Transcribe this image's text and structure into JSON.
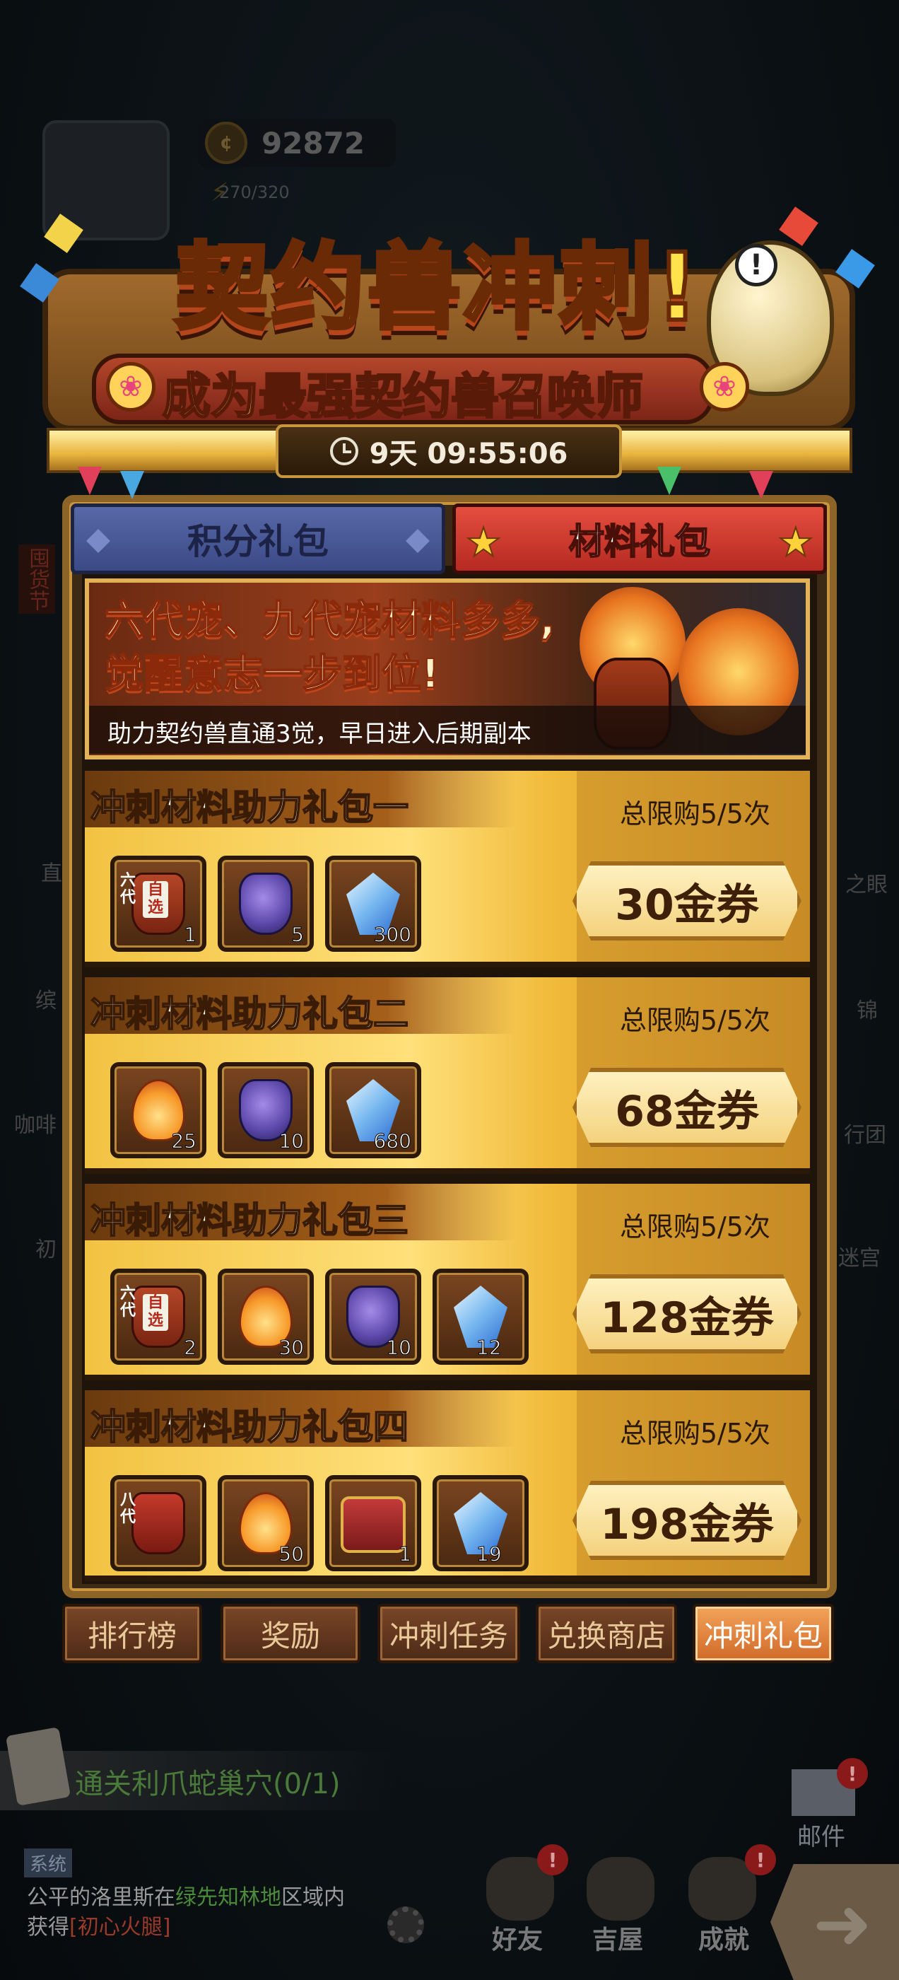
{
  "hud": {
    "currency_value": "92872",
    "energy": "270/320"
  },
  "header": {
    "title": "契约兽冲刺!",
    "subtitle": "成为最强契约兽召唤师",
    "timer": "9天 09:55:06"
  },
  "tabs": [
    {
      "label": "积分礼包",
      "active": false
    },
    {
      "label": "材料礼包",
      "active": true
    }
  ],
  "promo": {
    "line1": "六代宠、九代宠材料多多,",
    "line2": "觉醒意志一步到位!",
    "subtitle": "助力契约兽直通3觉，早日进入后期副本"
  },
  "packages": [
    {
      "title": "冲刺材料助力礼包一",
      "limit": "总限购5/5次",
      "price": "30金券",
      "items": [
        {
          "icon": "six-gen-select-jar-icon",
          "tier": "六代",
          "tag": "自选",
          "qty": "1"
        },
        {
          "icon": "purple-vase-icon",
          "qty": "5"
        },
        {
          "icon": "blue-crystal-icon",
          "qty": "300"
        }
      ]
    },
    {
      "title": "冲刺材料助力礼包二",
      "limit": "总限购5/5次",
      "price": "68金券",
      "items": [
        {
          "icon": "flame-spirit-icon",
          "qty": "25"
        },
        {
          "icon": "purple-vase-icon",
          "qty": "10"
        },
        {
          "icon": "blue-crystal-icon",
          "qty": "680"
        }
      ]
    },
    {
      "title": "冲刺材料助力礼包三",
      "limit": "总限购5/5次",
      "price": "128金券",
      "items": [
        {
          "icon": "six-gen-select-jar-icon",
          "tier": "六代",
          "tag": "自选",
          "qty": "2"
        },
        {
          "icon": "flame-spirit-icon",
          "qty": "30"
        },
        {
          "icon": "purple-vase-icon",
          "qty": "10"
        },
        {
          "icon": "blue-crystal-icon",
          "qty": "12"
        }
      ]
    },
    {
      "title": "冲刺材料助力礼包四",
      "limit": "总限购5/5次",
      "price": "198金券",
      "items": [
        {
          "icon": "eight-gen-jar-icon",
          "tier": "八代",
          "qty": ""
        },
        {
          "icon": "flame-spirit-icon",
          "qty": "50"
        },
        {
          "icon": "treasure-chest-icon",
          "qty": "1"
        },
        {
          "icon": "blue-crystal-icon",
          "qty": "19"
        }
      ]
    }
  ],
  "nav": [
    {
      "label": "排行榜",
      "active": false
    },
    {
      "label": "奖励",
      "active": false
    },
    {
      "label": "冲刺任务",
      "active": false
    },
    {
      "label": "兑换商店",
      "active": false
    },
    {
      "label": "冲刺礼包",
      "active": true
    }
  ],
  "quest": {
    "text": "通关利爪蛇巢穴(0/1)"
  },
  "chat": {
    "tag": "系统",
    "line1_prefix": "公平的洛里斯在",
    "line1_place": "绿先知林地",
    "line1_suffix": "区域内",
    "line2_prefix": "获得",
    "line2_item": "[初心火腿]"
  },
  "bottom_bar": {
    "friends": "好友",
    "house": "吉屋",
    "achievements": "成就",
    "mail": "邮件",
    "badge": "!"
  },
  "side_labels": {
    "left": [
      "囤货节",
      "直",
      "缤",
      "咖啡",
      "初"
    ],
    "right": [
      "之眼",
      "锦",
      "行团",
      "迷宫"
    ]
  },
  "colors": {
    "panel_border": "#8d6427",
    "tab_active": "#e54e3e",
    "tab_inactive": "#5868a8",
    "package_gold": "#ffe07a",
    "nav_active": "#f3a35a"
  }
}
